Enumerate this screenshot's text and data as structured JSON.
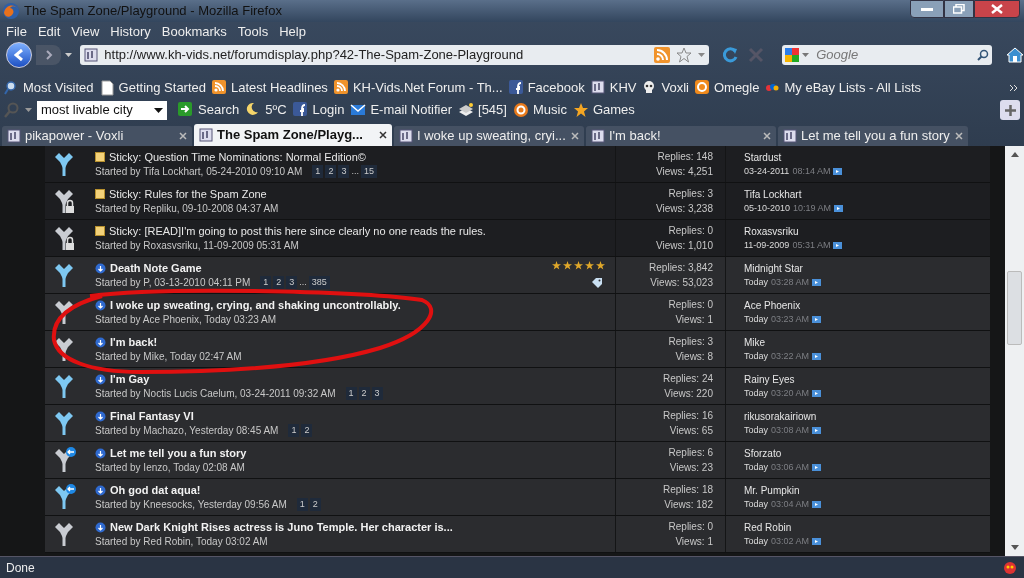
{
  "window": {
    "title": "The Spam Zone/Playground - Mozilla Firefox"
  },
  "menu": [
    "File",
    "Edit",
    "View",
    "History",
    "Bookmarks",
    "Tools",
    "Help"
  ],
  "nav": {
    "url": "http://www.kh-vids.net/forumdisplay.php?42-The-Spam-Zone-Playground",
    "search_placeholder": "Google"
  },
  "bookmarks": [
    {
      "label": "Most Visited",
      "kind": "search"
    },
    {
      "label": "Getting Started",
      "kind": "page"
    },
    {
      "label": "Latest Headlines",
      "kind": "feed"
    },
    {
      "label": "KH-Vids.Net Forum - Th...",
      "kind": "feed"
    },
    {
      "label": "Facebook",
      "kind": "facebook"
    },
    {
      "label": "KHV",
      "kind": "site"
    },
    {
      "label": "Voxli",
      "kind": "skull"
    },
    {
      "label": "Omegle",
      "kind": "omegle"
    },
    {
      "label": "My eBay Lists - All Lists",
      "kind": "ebay"
    }
  ],
  "toolbar": {
    "search_value": "most livable city",
    "items": [
      {
        "label": "Search",
        "kind": "go"
      },
      {
        "label": "5ºC",
        "kind": "moon"
      },
      {
        "label": "Login",
        "kind": "facebook"
      },
      {
        "label": "E-mail Notifier",
        "kind": "mail"
      },
      {
        "label": "[545]",
        "kind": "books"
      },
      {
        "label": "Music",
        "kind": "music"
      },
      {
        "label": "Games",
        "kind": "star"
      }
    ]
  },
  "tabs": [
    {
      "label": "pikapower - Voxli",
      "selected": false
    },
    {
      "label": "The Spam Zone/Playg...",
      "selected": true
    },
    {
      "label": "I woke up sweating, cryi...",
      "selected": false
    },
    {
      "label": "I'm back!",
      "selected": false
    },
    {
      "label": "Let me tell you a fun story",
      "selected": false
    }
  ],
  "threads": [
    {
      "sticky": true,
      "new": true,
      "locked": false,
      "participated": false,
      "prefix": "Sticky:",
      "title": "Question Time Nominations: Normal Edition©",
      "started": "Started by Tifa Lockhart, 05-24-2010 09:10 AM",
      "pages": [
        "1",
        "2",
        "3",
        "...",
        "15"
      ],
      "replies": "Replies: 148",
      "views": "Views: 4,251",
      "last_user": "Stardust",
      "last_date": "03-24-2011",
      "last_time": "08:14 AM"
    },
    {
      "sticky": true,
      "new": false,
      "locked": true,
      "participated": false,
      "prefix": "Sticky:",
      "title": "Rules for the Spam Zone",
      "started": "Started by Repliku, 09-10-2008 04:37 AM",
      "replies": "Replies: 3",
      "views": "Views: 3,238",
      "last_user": "Tifa Lockhart",
      "last_date": "05-10-2010",
      "last_time": "10:19 AM"
    },
    {
      "sticky": true,
      "new": false,
      "locked": true,
      "participated": false,
      "prefix": "Sticky:",
      "title": "[READ]I'm going to post this here since clearly no one reads the rules.",
      "started": "Started by Roxasvsriku, 11-09-2009 05:31 AM",
      "replies": "Replies: 0",
      "views": "Views: 1,010",
      "last_user": "Roxasvsriku",
      "last_date": "11-09-2009",
      "last_time": "05:31 AM"
    },
    {
      "sticky": false,
      "new": true,
      "locked": false,
      "participated": false,
      "title": "Death Note Game",
      "started": "Started by P, 03-13-2010 04:11 PM",
      "pages": [
        "1",
        "2",
        "3",
        "...",
        "385"
      ],
      "stars": 5,
      "tagged": true,
      "replies": "Replies: 3,842",
      "views": "Views: 53,023",
      "last_user": "Midnight Star",
      "last_date": "Today",
      "last_time": "03:28 AM"
    },
    {
      "sticky": false,
      "new": false,
      "locked": false,
      "participated": false,
      "title": "I woke up sweating, crying, and shaking uncontrollably.",
      "started": "Started by Ace Phoenix, Today 03:23 AM",
      "replies": "Replies: 0",
      "views": "Views: 1",
      "last_user": "Ace Phoenix",
      "last_date": "Today",
      "last_time": "03:23 AM"
    },
    {
      "sticky": false,
      "new": false,
      "locked": false,
      "participated": false,
      "title": "I'm back!",
      "started": "Started by Mike, Today 02:47 AM",
      "replies": "Replies: 3",
      "views": "Views: 8",
      "last_user": "Mike",
      "last_date": "Today",
      "last_time": "03:22 AM"
    },
    {
      "sticky": false,
      "new": true,
      "locked": false,
      "participated": false,
      "title": "I'm Gay",
      "started": "Started by Noctis Lucis Caelum, 03-24-2011 09:32 AM",
      "pages": [
        "1",
        "2",
        "3"
      ],
      "replies": "Replies: 24",
      "views": "Views: 220",
      "last_user": "Rainy Eyes",
      "last_date": "Today",
      "last_time": "03:20 AM"
    },
    {
      "sticky": false,
      "new": true,
      "locked": false,
      "participated": false,
      "title": "Final Fantasy VI",
      "started": "Started by Machazo, Yesterday 08:45 AM",
      "pages": [
        "1",
        "2"
      ],
      "replies": "Replies: 16",
      "views": "Views: 65",
      "last_user": "rikusorakairiown",
      "last_date": "Today",
      "last_time": "03:08 AM"
    },
    {
      "sticky": false,
      "new": false,
      "locked": false,
      "participated": true,
      "title": "Let me tell you a fun story",
      "started": "Started by Ienzo, Today 02:08 AM",
      "replies": "Replies: 6",
      "views": "Views: 23",
      "last_user": "Sforzato",
      "last_date": "Today",
      "last_time": "03:06 AM"
    },
    {
      "sticky": false,
      "new": true,
      "locked": false,
      "participated": true,
      "title": "Oh god dat aqua!",
      "started": "Started by Kneesocks, Yesterday 09:56 AM",
      "pages": [
        "1",
        "2"
      ],
      "replies": "Replies: 18",
      "views": "Views: 182",
      "last_user": "Mr. Pumpkin",
      "last_date": "Today",
      "last_time": "03:04 AM"
    },
    {
      "sticky": false,
      "new": false,
      "locked": false,
      "participated": false,
      "title": "New Dark Knight Rises actress is Juno Temple. Her character is...",
      "started": "Started by Red Robin, Today 03:02 AM",
      "replies": "Replies: 0",
      "views": "Views: 1",
      "last_user": "Red Robin",
      "last_date": "Today",
      "last_time": "03:02 AM"
    }
  ],
  "status_bar": {
    "text": "Done"
  }
}
